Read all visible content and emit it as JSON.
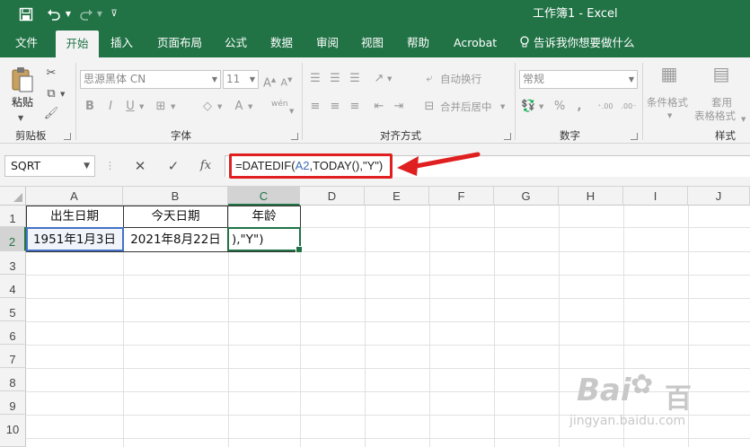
{
  "window": {
    "title": "工作簿1  -  Excel"
  },
  "tabs": [
    "文件",
    "开始",
    "插入",
    "页面布局",
    "公式",
    "数据",
    "审阅",
    "视图",
    "帮助",
    "Acrobat",
    "告诉我你想要做什么"
  ],
  "ribbon": {
    "clipboard": {
      "paste_label": "粘贴",
      "group_label": "剪贴板"
    },
    "font": {
      "font_name": "思源黑体 CN",
      "font_size": "11",
      "wen_label": "wén",
      "group_label": "字体"
    },
    "alignment": {
      "wrap_label": "自动换行",
      "merge_label": "合并后居中",
      "group_label": "对齐方式"
    },
    "number": {
      "format": "常规",
      "group_label": "数字"
    },
    "styles": {
      "cond_format": "条件格式",
      "table_format_1": "套用",
      "table_format_2": "表格格式",
      "group_label": "样式"
    }
  },
  "formula_bar": {
    "name_box": "SQRT",
    "formula_prefix": "=DATEDIF(",
    "formula_ref": "A2",
    "formula_suffix": ",TODAY(),\"Y\")"
  },
  "columns": [
    "A",
    "B",
    "C",
    "D",
    "E",
    "F",
    "G",
    "H",
    "I",
    "J"
  ],
  "rows": [
    "1",
    "2",
    "3",
    "4",
    "5",
    "6",
    "7",
    "8",
    "9",
    "10"
  ],
  "cells": {
    "A1": "出生日期",
    "B1": "今天日期",
    "C1": "年龄",
    "A2": "1951年1月3日",
    "B2": "2021年8月22日",
    "C2": "),\"Y\")"
  },
  "watermark": {
    "brand": "Bai",
    "brand_tail": "百",
    "domain": "jingyan.baidu.com"
  },
  "colors": {
    "excel_green": "#217346",
    "highlight_red": "#e02020",
    "ref_blue": "#3b6fb6"
  }
}
